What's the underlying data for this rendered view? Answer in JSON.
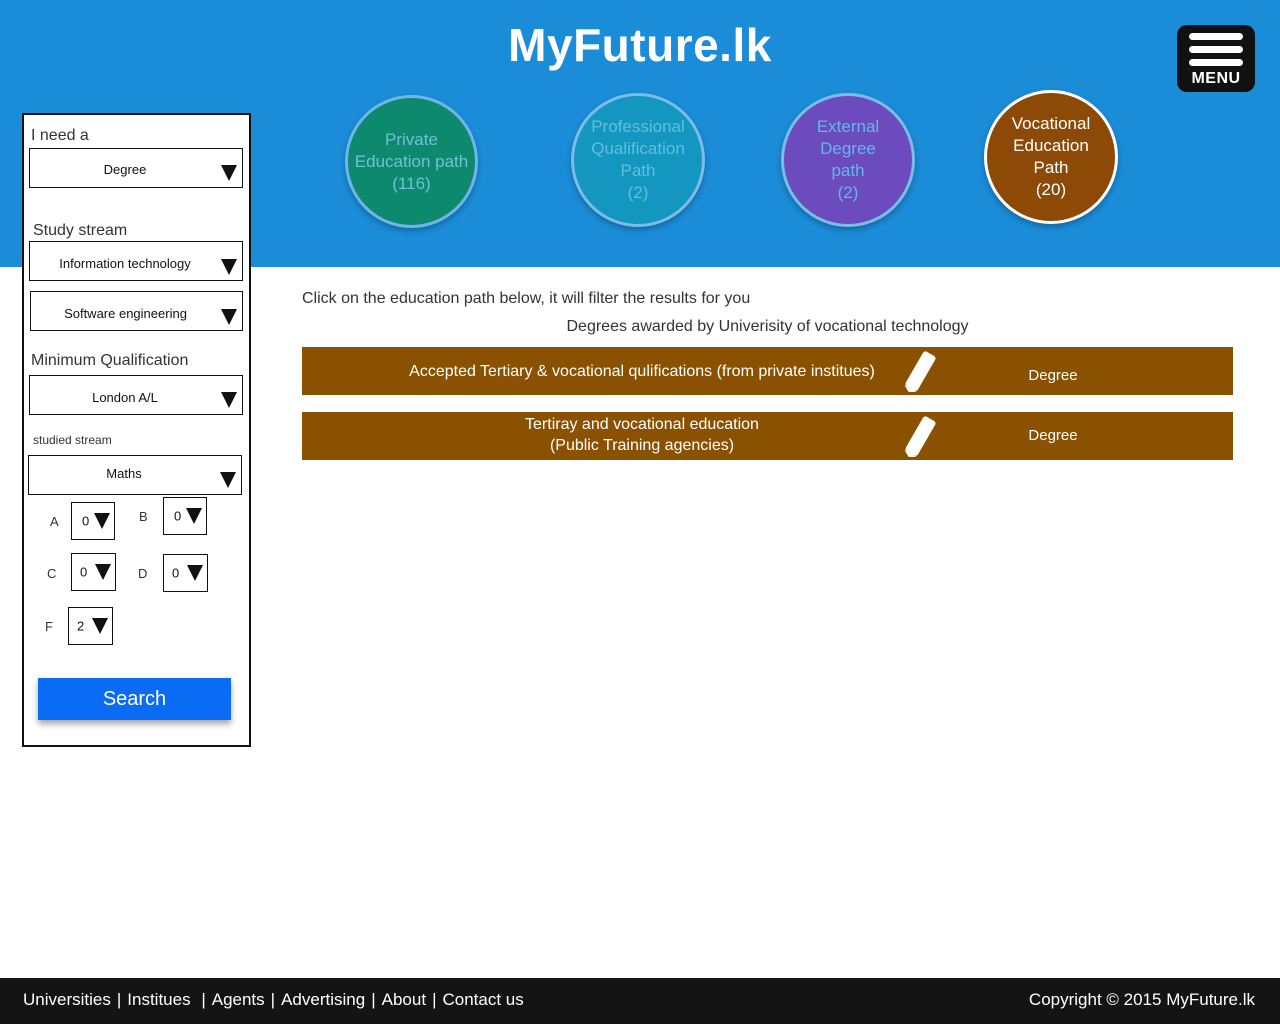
{
  "header": {
    "logo": "MyFuture.lk",
    "menu_label": "MENU",
    "paths": [
      {
        "lines": [
          "Private",
          "Education path",
          "(116)"
        ]
      },
      {
        "lines": [
          "Professional",
          "Qualification",
          "Path",
          "(2)"
        ]
      },
      {
        "lines": [
          "External",
          "Degree",
          "path",
          "(2)"
        ]
      },
      {
        "lines": [
          "Vocational",
          "Education",
          "Path",
          "(20)"
        ]
      }
    ]
  },
  "sidebar": {
    "need_label": "I need a",
    "need_value": "Degree",
    "stream_label": "Study stream",
    "stream_value": "Information technology",
    "substream_value": "Software engineering",
    "min_qual_label": "Minimum Qualification",
    "min_qual_value": "London A/L",
    "studied_label": "studied stream",
    "studied_value": "Maths",
    "grades": {
      "a_label": "A",
      "a_value": "0",
      "b_label": "B",
      "b_value": "0",
      "c_label": "C",
      "c_value": "0",
      "d_label": "D",
      "d_value": "0",
      "f_label": "F",
      "f_value": "2"
    },
    "search_label": "Search"
  },
  "main": {
    "intro": "Click on the education path below, it will filter the results for you",
    "subtitle": "Degrees awarded by Univerisity of vocational technology",
    "rows": [
      {
        "path_line1": "Accepted Tertiary & vocational qulifications (from private institues)",
        "path_line2": "",
        "award": "Degree"
      },
      {
        "path_line1": "Tertiray and vocational education",
        "path_line2": "(Public Training agencies)",
        "award": "Degree"
      }
    ]
  },
  "footer": {
    "links": [
      "Universities",
      "Institues",
      "Agents",
      "Advertising",
      "About",
      "Contact us"
    ],
    "copyright": "Copyright © 2015 MyFuture.lk"
  },
  "colors": {
    "header_bg": "#1a8cd8",
    "row_bg": "#8a5100",
    "search_bg": "#0a6cf5",
    "footer_bg": "#141414"
  },
  "icons": [
    "menu-icon",
    "dropdown-arrow-icon",
    "pencil-icon"
  ]
}
